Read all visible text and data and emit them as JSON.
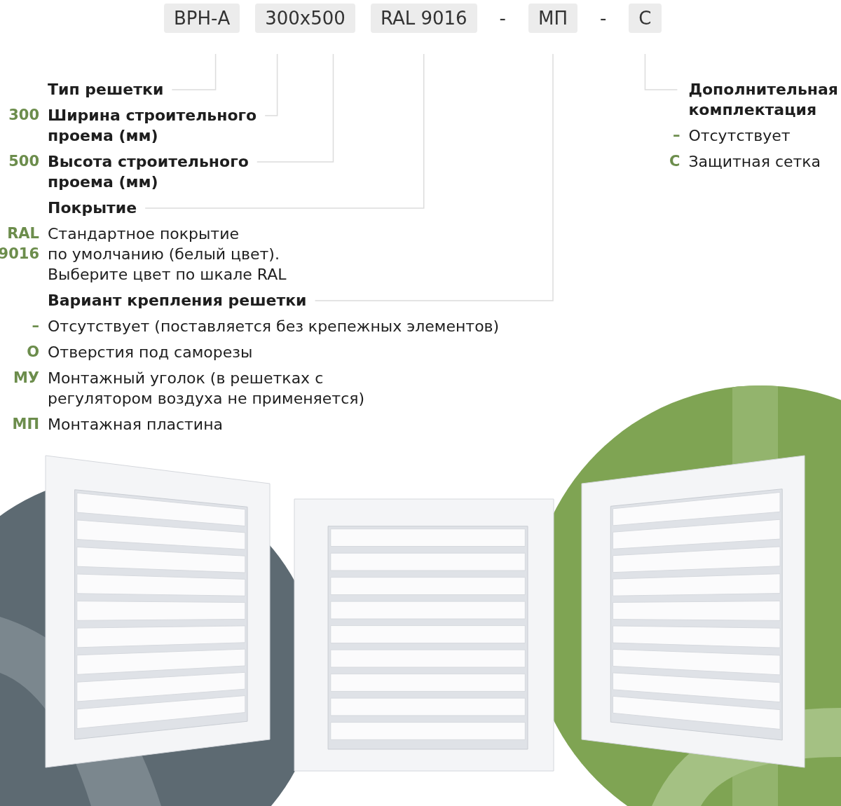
{
  "code": [
    {
      "kind": "chip",
      "text": "ВРН-А"
    },
    {
      "kind": "chip",
      "text": "300x500"
    },
    {
      "kind": "chip",
      "text": "RAL 9016"
    },
    {
      "kind": "separator",
      "text": "-"
    },
    {
      "kind": "chip",
      "text": "МП"
    },
    {
      "kind": "separator",
      "text": "-"
    },
    {
      "kind": "chip",
      "text": "С"
    }
  ],
  "left_list": [
    {
      "kind": "heading",
      "text": "Тип решетки"
    },
    {
      "kind": "heading",
      "code": "300",
      "text": "Ширина строительного\nпроема (мм)"
    },
    {
      "kind": "heading",
      "code": "500",
      "text": "Высота строительного\nпроема (мм)"
    },
    {
      "kind": "heading",
      "text": "Покрытие"
    },
    {
      "kind": "option",
      "code": "RAL 9016",
      "text": "Стандартное покрытие\nпо умолчанию (белый цвет).\nВыберите цвет по шкале RAL"
    },
    {
      "kind": "heading",
      "text": "Вариант крепления решетки"
    },
    {
      "kind": "option",
      "code": "–",
      "text": "Отсутствует (поставляется без крепежных элементов)"
    },
    {
      "kind": "option",
      "code": "О",
      "text": "Отверстия под саморезы"
    },
    {
      "kind": "option",
      "code": "МУ",
      "text": "Монтажный уголок (в решетках с\nрегулятором воздуха не применяется)"
    },
    {
      "kind": "option",
      "code": "МП",
      "text": "Монтажная пластина"
    }
  ],
  "right_list": [
    {
      "kind": "heading",
      "text": "Дополнительная\nкомплектация"
    },
    {
      "kind": "option",
      "code": "–",
      "text": "Отсутствует"
    },
    {
      "kind": "option",
      "code": "С",
      "text": "Защитная сетка"
    }
  ]
}
